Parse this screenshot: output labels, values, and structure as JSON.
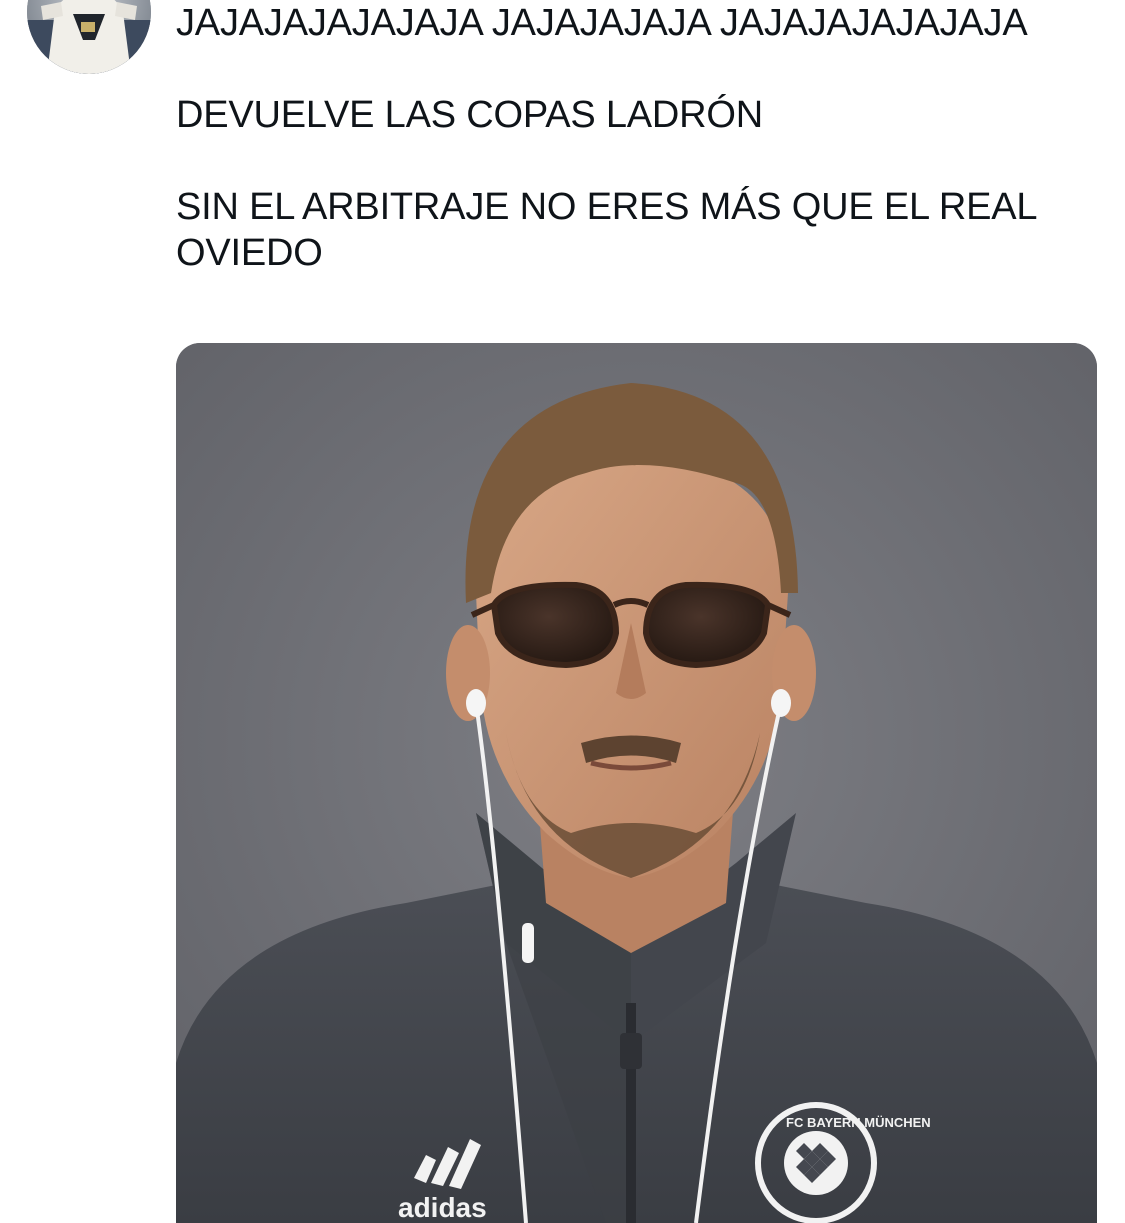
{
  "tweet": {
    "author_avatar_icon": "profile-avatar-icon",
    "paragraphs": [
      "JAJAJAJAJAJAJA JAJAJAJAJA JAJAJAJAJAJAJA",
      "DEVUELVE LAS COPAS LADRÓN",
      "SIN EL ARBITRAJE NO ERES MÁS QUE EL REAL OVIEDO"
    ]
  },
  "media": {
    "type": "photo",
    "jacket_logo_text": "adidas",
    "crest_text": "FC BAYERN MÜNCHEN"
  }
}
